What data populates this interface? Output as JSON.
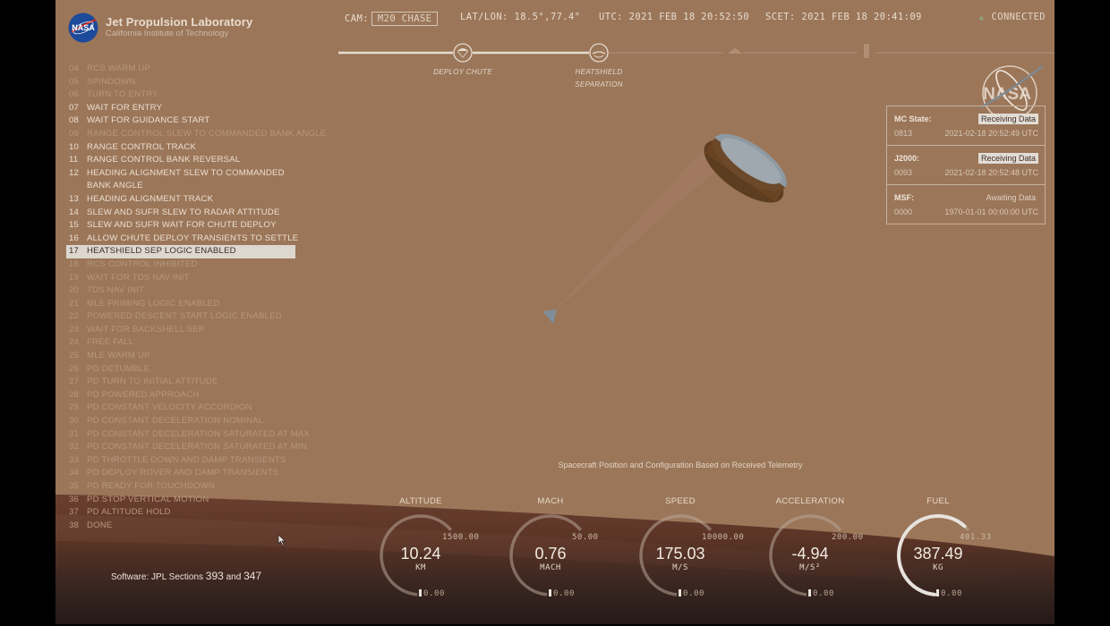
{
  "header": {
    "org_name": "Jet Propulsion Laboratory",
    "org_sub": "California Institute of Technology",
    "cam_label": "CAM:",
    "cam_value": "M20 CHASE",
    "latlon_label": "LAT/LON:",
    "latlon_value": "18.5°,77.4°",
    "utc_label": "UTC:",
    "utc_value": "2021 FEB 18 20:52:50",
    "scet_label": "SCET:",
    "scet_value": "2021 FEB 18 20:41:09",
    "connection_status": "CONNECTED",
    "connection_icon": "signal-icon"
  },
  "timeline": {
    "milestones": [
      {
        "label": "DEPLOY CHUTE",
        "icon": "parachute-icon",
        "state": "complete"
      },
      {
        "label": "HEATSHIELD SEPARATION",
        "label_line1": "HEATSHIELD",
        "label_line2": "SEPARATION",
        "icon": "heatshield-icon",
        "state": "complete"
      },
      {
        "label": "",
        "icon": "backshell-icon",
        "state": "upcoming"
      },
      {
        "label": "",
        "icon": "rover-icon",
        "state": "upcoming"
      }
    ]
  },
  "events": [
    {
      "num": "04",
      "label": "RCS WARM UP",
      "state": "pending"
    },
    {
      "num": "05",
      "label": "SPINDOWN",
      "state": "pending"
    },
    {
      "num": "06",
      "label": "TURN TO ENTRY",
      "state": "pending"
    },
    {
      "num": "07",
      "label": "WAIT FOR ENTRY",
      "state": "done"
    },
    {
      "num": "08",
      "label": "WAIT FOR GUIDANCE START",
      "state": "done"
    },
    {
      "num": "09",
      "label": "RANGE CONTROL SLEW TO COMMANDED BANK ANGLE",
      "state": "pending"
    },
    {
      "num": "10",
      "label": "RANGE CONTROL TRACK",
      "state": "done"
    },
    {
      "num": "11",
      "label": "RANGE CONTROL BANK REVERSAL",
      "state": "done"
    },
    {
      "num": "12",
      "label": "HEADING ALIGNMENT SLEW TO COMMANDED BANK ANGLE",
      "state": "done"
    },
    {
      "num": "13",
      "label": "HEADING ALIGNMENT TRACK",
      "state": "done"
    },
    {
      "num": "14",
      "label": "SLEW AND SUFR SLEW TO RADAR ATTITUDE",
      "state": "done"
    },
    {
      "num": "15",
      "label": "SLEW AND SUFR WAIT FOR CHUTE DEPLOY",
      "state": "done"
    },
    {
      "num": "16",
      "label": "ALLOW CHUTE DEPLOY TRANSIENTS TO SETTLE",
      "state": "done"
    },
    {
      "num": "17",
      "label": "HEATSHIELD SEP LOGIC ENABLED",
      "state": "active"
    },
    {
      "num": "18",
      "label": "RCS CONTROL INHIBITED",
      "state": "pending"
    },
    {
      "num": "19",
      "label": "WAIT FOR TDS NAV INIT",
      "state": "pending"
    },
    {
      "num": "20",
      "label": "TDS NAV INIT",
      "state": "pending"
    },
    {
      "num": "21",
      "label": "MLE PRIMING LOGIC ENABLED",
      "state": "pending"
    },
    {
      "num": "22",
      "label": "POWERED DESCENT START LOGIC ENABLED",
      "state": "pending"
    },
    {
      "num": "23",
      "label": "WAIT FOR BACKSHELL SEP",
      "state": "pending"
    },
    {
      "num": "24",
      "label": "FREE FALL",
      "state": "pending"
    },
    {
      "num": "25",
      "label": "MLE WARM UP",
      "state": "pending"
    },
    {
      "num": "26",
      "label": "PD DETUMBLE",
      "state": "pending"
    },
    {
      "num": "27",
      "label": "PD TURN TO INITIAL ATTITUDE",
      "state": "pending"
    },
    {
      "num": "28",
      "label": "PD POWERED APPROACH",
      "state": "pending"
    },
    {
      "num": "29",
      "label": "PD CONSTANT VELOCITY ACCORDION",
      "state": "pending"
    },
    {
      "num": "30",
      "label": "PD CONSTANT DECELERATION NOMINAL",
      "state": "pending"
    },
    {
      "num": "31",
      "label": "PD CONSTANT DECELERATION SATURATED AT MAX",
      "state": "pending"
    },
    {
      "num": "32",
      "label": "PD CONSTANT DECELERATION SATURATED AT MIN",
      "state": "pending"
    },
    {
      "num": "33",
      "label": "PD THROTTLE DOWN AND DAMP TRANSIENTS",
      "state": "pending"
    },
    {
      "num": "34",
      "label": "PD DEPLOY ROVER AND DAMP TRANSIENTS",
      "state": "pending"
    },
    {
      "num": "35",
      "label": "PD READY FOR TOUCHDOWN",
      "state": "pending"
    },
    {
      "num": "36",
      "label": "PD STOP VERTICAL MOTION",
      "state": "pending"
    },
    {
      "num": "37",
      "label": "PD ALTITUDE HOLD",
      "state": "pending"
    },
    {
      "num": "38",
      "label": "DONE",
      "state": "pending"
    }
  ],
  "status_panel": {
    "watermark": "NASA",
    "rows": [
      {
        "name": "MC State:",
        "state": "Receiving Data",
        "state_kind": "recv",
        "id": "0813",
        "time": "2021-02-18 20:52:49 UTC"
      },
      {
        "name": "J2000:",
        "state": "Receiving Data",
        "state_kind": "recv",
        "id": "0093",
        "time": "2021-02-18 20:52:48 UTC"
      },
      {
        "name": "MSF:",
        "state": "Awaiting Data",
        "state_kind": "await",
        "id": "0000",
        "time": "1970-01-01 00:00:00 UTC"
      }
    ]
  },
  "scene": {
    "caption": "Spacecraft Position and Configuration Based on Received Telemetry",
    "software_prefix": "Software: JPL Sections ",
    "software_num1": "393",
    "software_and": " and ",
    "software_num2": "347"
  },
  "gauges": [
    {
      "title": "ALTITUDE",
      "value": "10.24",
      "unit": "KM",
      "max": "1500.00",
      "min": "0.00",
      "fraction": 0.0068
    },
    {
      "title": "MACH",
      "value": "0.76",
      "unit": "MACH",
      "max": "50.00",
      "min": "0.00",
      "fraction": 0.0152
    },
    {
      "title": "SPEED",
      "value": "175.03",
      "unit": "M/S",
      "max": "10000.00",
      "min": "0.00",
      "fraction": 0.0175
    },
    {
      "title": "ACCELERATION",
      "value": "-4.94",
      "unit": "M/S²",
      "max": "200.00",
      "min": "0.00",
      "fraction": 0.0
    },
    {
      "title": "FUEL",
      "value": "387.49",
      "unit": "KG",
      "max": "401.33",
      "min": "0.00",
      "fraction": 0.9655
    }
  ],
  "colors": {
    "sky": "#9b7659",
    "ground_dark": "#2e1f1b",
    "ground_mid": "#5a3527",
    "text_primary": "#ecdfd0",
    "text_dim": "#b8977c",
    "highlight_bg": "#ddd7d0",
    "nasa_blue": "#1d4a9a",
    "nasa_red": "#d52b1e"
  }
}
